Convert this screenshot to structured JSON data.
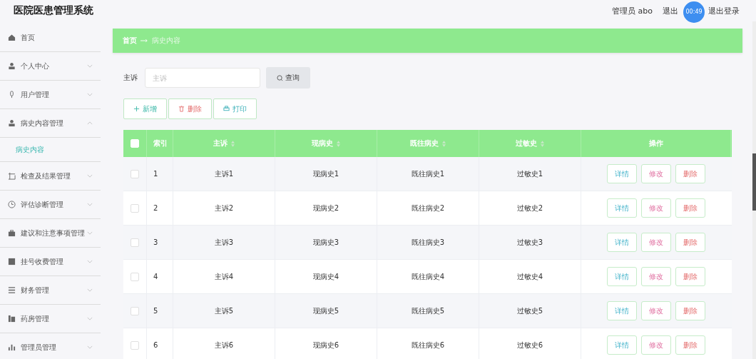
{
  "header": {
    "title": "医院医患管理系统",
    "user": "管理员 abo",
    "links": [
      "退出",
      "退出登录"
    ],
    "timer": "00:49"
  },
  "sidebar": {
    "items": [
      {
        "label": "首页",
        "kind": "link"
      },
      {
        "label": "个人中心",
        "kind": "menu",
        "expanded": false
      },
      {
        "label": "用户管理",
        "kind": "menu",
        "expanded": false
      },
      {
        "label": "病史内容管理",
        "kind": "menu",
        "expanded": true,
        "children": [
          {
            "label": "病史内容",
            "selected": true
          }
        ]
      },
      {
        "label": "检查及结果管理",
        "kind": "menu",
        "expanded": false
      },
      {
        "label": "评估诊断管理",
        "kind": "menu",
        "expanded": false
      },
      {
        "label": "建议和注意事项管理",
        "kind": "menu",
        "expanded": false
      },
      {
        "label": "挂号收费管理",
        "kind": "menu",
        "expanded": false
      },
      {
        "label": "财务管理",
        "kind": "menu",
        "expanded": false
      },
      {
        "label": "药房管理",
        "kind": "menu",
        "expanded": false
      },
      {
        "label": "管理员管理",
        "kind": "menu",
        "expanded": false
      }
    ]
  },
  "breadcrumb": [
    "首页",
    "病史内容"
  ],
  "search": {
    "label": "主诉",
    "placeholder": "主诉",
    "button": "查询"
  },
  "actions": [
    "新增",
    "删除",
    "打印"
  ],
  "table": {
    "columns": [
      {
        "label": "索引",
        "sortable": false
      },
      {
        "label": "主诉",
        "sortable": true
      },
      {
        "label": "现病史",
        "sortable": true
      },
      {
        "label": "既往病史",
        "sortable": true
      },
      {
        "label": "过敏史",
        "sortable": true
      },
      {
        "label": "操作",
        "sortable": false
      }
    ],
    "header_checked": false,
    "rows": [
      {
        "checked": false,
        "cells": [
          "1",
          "主诉1",
          "现病史1",
          "既往病史1",
          "过敏史1"
        ],
        "buttons": [
          "详情",
          "修改",
          "删除"
        ]
      },
      {
        "checked": false,
        "cells": [
          "2",
          "主诉2",
          "现病史2",
          "既往病史2",
          "过敏史2"
        ],
        "buttons": [
          "详情",
          "修改",
          "删除"
        ]
      },
      {
        "checked": false,
        "cells": [
          "3",
          "主诉3",
          "现病史3",
          "既往病史3",
          "过敏史3"
        ],
        "buttons": [
          "详情",
          "修改",
          "删除"
        ]
      },
      {
        "checked": false,
        "cells": [
          "4",
          "主诉4",
          "现病史4",
          "既往病史4",
          "过敏史4"
        ],
        "buttons": [
          "详情",
          "修改",
          "删除"
        ]
      },
      {
        "checked": false,
        "cells": [
          "5",
          "主诉5",
          "现病史5",
          "既往病史5",
          "过敏史5"
        ],
        "buttons": [
          "详情",
          "修改",
          "删除"
        ]
      },
      {
        "checked": false,
        "cells": [
          "6",
          "主诉6",
          "现病史6",
          "既往病史6",
          "过敏史6"
        ],
        "buttons": [
          "详情",
          "修改",
          "删除"
        ]
      }
    ]
  }
}
